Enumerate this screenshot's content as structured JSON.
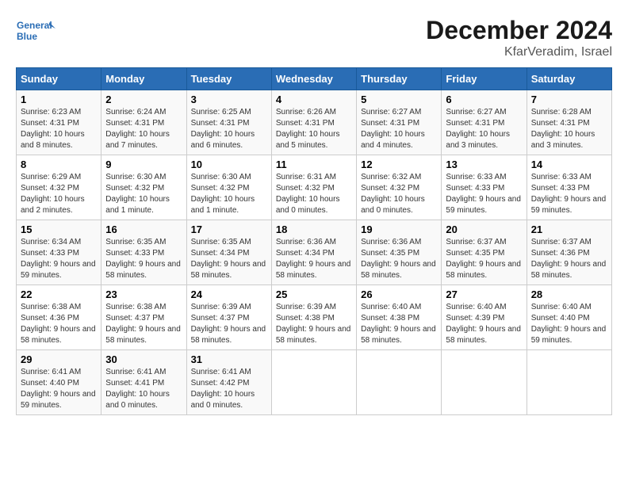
{
  "header": {
    "logo_line1": "General",
    "logo_line2": "Blue",
    "title": "December 2024",
    "subtitle": "KfarVeradim, Israel"
  },
  "weekdays": [
    "Sunday",
    "Monday",
    "Tuesday",
    "Wednesday",
    "Thursday",
    "Friday",
    "Saturday"
  ],
  "weeks": [
    [
      {
        "day": "1",
        "sunrise": "6:23 AM",
        "sunset": "4:31 PM",
        "daylight": "10 hours and 8 minutes."
      },
      {
        "day": "2",
        "sunrise": "6:24 AM",
        "sunset": "4:31 PM",
        "daylight": "10 hours and 7 minutes."
      },
      {
        "day": "3",
        "sunrise": "6:25 AM",
        "sunset": "4:31 PM",
        "daylight": "10 hours and 6 minutes."
      },
      {
        "day": "4",
        "sunrise": "6:26 AM",
        "sunset": "4:31 PM",
        "daylight": "10 hours and 5 minutes."
      },
      {
        "day": "5",
        "sunrise": "6:27 AM",
        "sunset": "4:31 PM",
        "daylight": "10 hours and 4 minutes."
      },
      {
        "day": "6",
        "sunrise": "6:27 AM",
        "sunset": "4:31 PM",
        "daylight": "10 hours and 3 minutes."
      },
      {
        "day": "7",
        "sunrise": "6:28 AM",
        "sunset": "4:31 PM",
        "daylight": "10 hours and 3 minutes."
      }
    ],
    [
      {
        "day": "8",
        "sunrise": "6:29 AM",
        "sunset": "4:32 PM",
        "daylight": "10 hours and 2 minutes."
      },
      {
        "day": "9",
        "sunrise": "6:30 AM",
        "sunset": "4:32 PM",
        "daylight": "10 hours and 1 minute."
      },
      {
        "day": "10",
        "sunrise": "6:30 AM",
        "sunset": "4:32 PM",
        "daylight": "10 hours and 1 minute."
      },
      {
        "day": "11",
        "sunrise": "6:31 AM",
        "sunset": "4:32 PM",
        "daylight": "10 hours and 0 minutes."
      },
      {
        "day": "12",
        "sunrise": "6:32 AM",
        "sunset": "4:32 PM",
        "daylight": "10 hours and 0 minutes."
      },
      {
        "day": "13",
        "sunrise": "6:33 AM",
        "sunset": "4:33 PM",
        "daylight": "9 hours and 59 minutes."
      },
      {
        "day": "14",
        "sunrise": "6:33 AM",
        "sunset": "4:33 PM",
        "daylight": "9 hours and 59 minutes."
      }
    ],
    [
      {
        "day": "15",
        "sunrise": "6:34 AM",
        "sunset": "4:33 PM",
        "daylight": "9 hours and 59 minutes."
      },
      {
        "day": "16",
        "sunrise": "6:35 AM",
        "sunset": "4:33 PM",
        "daylight": "9 hours and 58 minutes."
      },
      {
        "day": "17",
        "sunrise": "6:35 AM",
        "sunset": "4:34 PM",
        "daylight": "9 hours and 58 minutes."
      },
      {
        "day": "18",
        "sunrise": "6:36 AM",
        "sunset": "4:34 PM",
        "daylight": "9 hours and 58 minutes."
      },
      {
        "day": "19",
        "sunrise": "6:36 AM",
        "sunset": "4:35 PM",
        "daylight": "9 hours and 58 minutes."
      },
      {
        "day": "20",
        "sunrise": "6:37 AM",
        "sunset": "4:35 PM",
        "daylight": "9 hours and 58 minutes."
      },
      {
        "day": "21",
        "sunrise": "6:37 AM",
        "sunset": "4:36 PM",
        "daylight": "9 hours and 58 minutes."
      }
    ],
    [
      {
        "day": "22",
        "sunrise": "6:38 AM",
        "sunset": "4:36 PM",
        "daylight": "9 hours and 58 minutes."
      },
      {
        "day": "23",
        "sunrise": "6:38 AM",
        "sunset": "4:37 PM",
        "daylight": "9 hours and 58 minutes."
      },
      {
        "day": "24",
        "sunrise": "6:39 AM",
        "sunset": "4:37 PM",
        "daylight": "9 hours and 58 minutes."
      },
      {
        "day": "25",
        "sunrise": "6:39 AM",
        "sunset": "4:38 PM",
        "daylight": "9 hours and 58 minutes."
      },
      {
        "day": "26",
        "sunrise": "6:40 AM",
        "sunset": "4:38 PM",
        "daylight": "9 hours and 58 minutes."
      },
      {
        "day": "27",
        "sunrise": "6:40 AM",
        "sunset": "4:39 PM",
        "daylight": "9 hours and 58 minutes."
      },
      {
        "day": "28",
        "sunrise": "6:40 AM",
        "sunset": "4:40 PM",
        "daylight": "9 hours and 59 minutes."
      }
    ],
    [
      {
        "day": "29",
        "sunrise": "6:41 AM",
        "sunset": "4:40 PM",
        "daylight": "9 hours and 59 minutes."
      },
      {
        "day": "30",
        "sunrise": "6:41 AM",
        "sunset": "4:41 PM",
        "daylight": "10 hours and 0 minutes."
      },
      {
        "day": "31",
        "sunrise": "6:41 AM",
        "sunset": "4:42 PM",
        "daylight": "10 hours and 0 minutes."
      },
      null,
      null,
      null,
      null
    ]
  ],
  "labels": {
    "sunrise_prefix": "Sunrise: ",
    "sunset_prefix": "Sunset: ",
    "daylight_prefix": "Daylight: "
  }
}
